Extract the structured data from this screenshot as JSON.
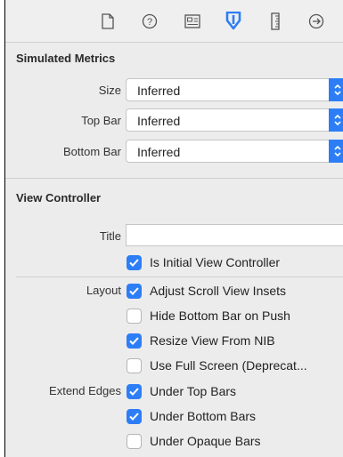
{
  "toolbar": {
    "tabs": [
      {
        "name": "file-inspector",
        "icon": "document-icon"
      },
      {
        "name": "quick-help-inspector",
        "icon": "help-icon"
      },
      {
        "name": "identity-inspector",
        "icon": "identity-card-icon"
      },
      {
        "name": "attributes-inspector",
        "icon": "attributes-icon",
        "selected": true
      },
      {
        "name": "size-inspector",
        "icon": "ruler-icon"
      },
      {
        "name": "connections-inspector",
        "icon": "arrow-circle-icon"
      }
    ]
  },
  "simulated_metrics": {
    "header": "Simulated Metrics",
    "fields": [
      {
        "label": "Size",
        "value": "Inferred"
      },
      {
        "label": "Top Bar",
        "value": "Inferred"
      },
      {
        "label": "Bottom Bar",
        "value": "Inferred"
      }
    ]
  },
  "view_controller": {
    "header": "View Controller",
    "title_label": "Title",
    "title_value": "",
    "initial": {
      "label": "Is Initial View Controller",
      "checked": true
    },
    "layout_label": "Layout",
    "layout_options": [
      {
        "label": "Adjust Scroll View Insets",
        "checked": true
      },
      {
        "label": "Hide Bottom Bar on Push",
        "checked": false
      },
      {
        "label": "Resize View From NIB",
        "checked": true
      },
      {
        "label": "Use Full Screen (Deprecat...",
        "checked": false
      }
    ],
    "extend_edges_label": "Extend Edges",
    "extend_edges_options": [
      {
        "label": "Under Top Bars",
        "checked": true
      },
      {
        "label": "Under Bottom Bars",
        "checked": true
      },
      {
        "label": "Under Opaque Bars",
        "checked": false
      }
    ]
  },
  "colors": {
    "accent": "#2d7ef6",
    "panel_bg": "#ececec",
    "divider": "#cfcfcf"
  }
}
